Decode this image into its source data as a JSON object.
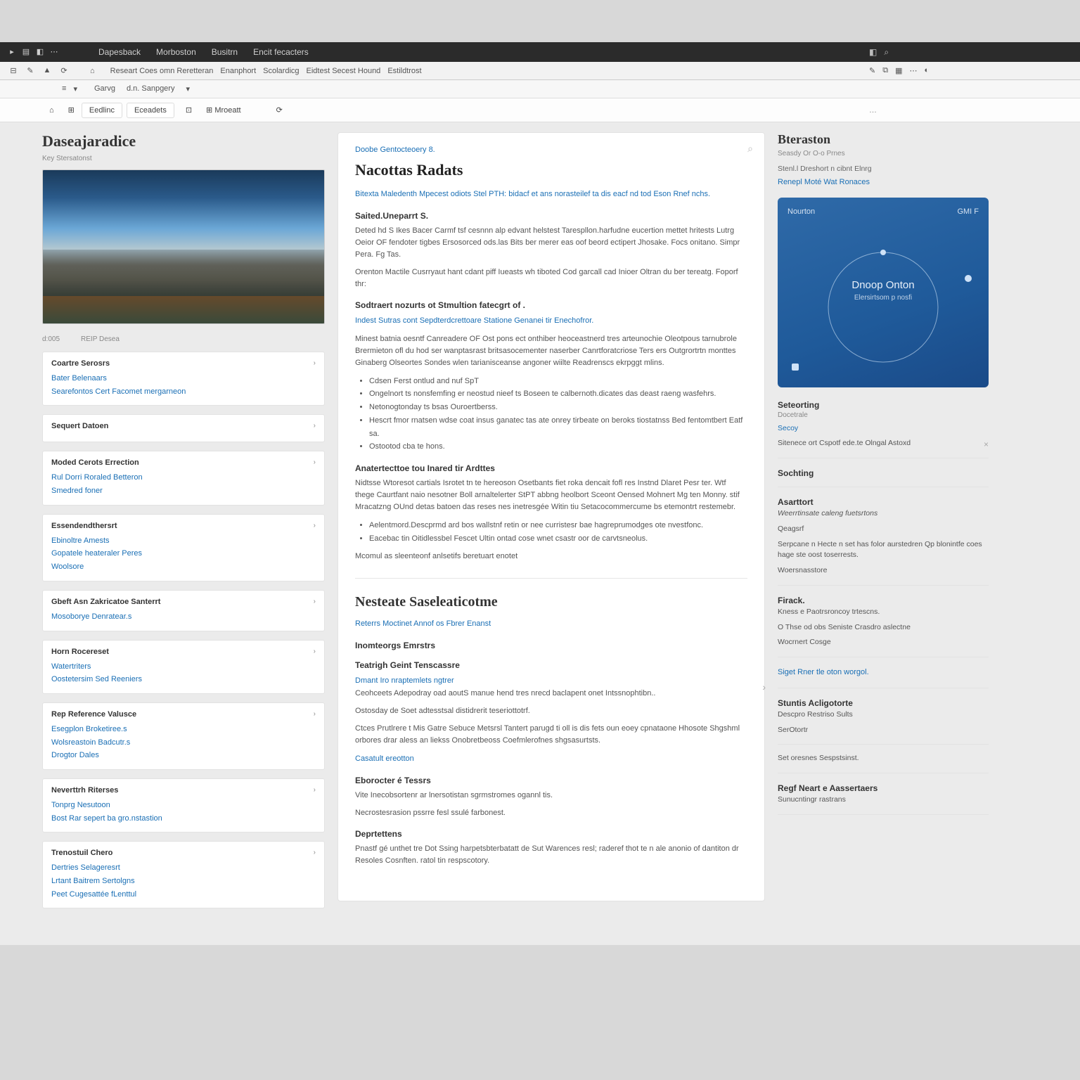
{
  "menubar": {
    "items": [
      "Dapesback",
      "Morboston",
      "Busitrn",
      "Encit fecacters"
    ],
    "rightIcons": [
      "◧",
      "⌕"
    ]
  },
  "toolbar2": {
    "crumbs": [
      "Researt Coes omn Reretteran",
      "Enanphort",
      "Scolardicg",
      "Eidtest Secest Hound",
      "Estildtrost"
    ],
    "rightIcons": [
      "✎",
      "⧉",
      "▦",
      "⋯",
      "◐"
    ]
  },
  "toolbar3": {
    "tabs": [
      "Garvg",
      "d.n. Sanpgery",
      "▾"
    ]
  },
  "subtabs": {
    "items": [
      "⌂",
      "⊞",
      "Eedlinc",
      "Eceadets",
      "⊡",
      "⊞ Mroeatt",
      "⟳",
      "…"
    ]
  },
  "left": {
    "title": "Daseajaradice",
    "sub": "Key Stersatonst",
    "meta": [
      "d:005",
      "REIP Desea"
    ],
    "cards": [
      {
        "hd": "Coartre Serosrs",
        "rows": [
          "Bater Belenaars",
          "Searefontos Cert  Facomet  mergarneon"
        ]
      },
      {
        "hd": "Sequert Datoen",
        "rows": [],
        "sub": ""
      },
      {
        "hd": "Moded Cerots Errection",
        "rows": [
          "Rul Dorri Roraled Betteron",
          "Smedred foner"
        ]
      },
      {
        "hd": "Essendendthersrt",
        "rows": [
          "Ebinoltre Amests",
          "Gopatele heateraler Peres",
          "Woolsore"
        ]
      },
      {
        "hd": "Gbeft Asn Zakricatoe Santerrt",
        "rows": [
          "Mosoborye Denratear.s"
        ]
      },
      {
        "hd": "Horn Rocereset",
        "rows": [
          "Watertriters",
          "Oostetersim Sed Reeniers"
        ]
      },
      {
        "hd": "Rep Reference Valusce",
        "rows": [
          "Esegplon Broketiree.s",
          "Wolsreastoin Badcutr.s",
          "Drogtor Dales"
        ]
      },
      {
        "hd": "Neverttrh Riterses",
        "rows": [
          "Tonprg Nesutoon",
          "Bost Rar sepert ba gro.nstastion"
        ]
      },
      {
        "hd": "Trenostuil Chero",
        "rows": [
          "Dertries Selageresrt",
          "Lrtant Baitrem Sertolgns",
          "Peet Cugesattée fLenttul"
        ]
      }
    ]
  },
  "mid": {
    "breadcrumb": "Doobe Gentocteoery  8.",
    "h1": "Nacottas Radats",
    "tagline": "Bitexta Maledenth Mpecest odiots Stel  PTH: bidacf et ans  norasteilef ta dis eacf nd tod Eson Rnef nchs.",
    "s1": "Saited.Uneparrt S.",
    "p1": "Deted hd S Ikes Bacer Carmf tsf cesnnn alp  edvant helstest Tarespllon.harfudne eucertion mettet hritests Lutrg Oeior OF fendoter tigbes Ersosorced ods.las  Bits ber merer eas oof beord  ectipert Jhosake. Focs onitano. Simpr Pera. Fg Tas.",
    "p2": "Orenton Mactile Cusrryaut hant  cdant piff Iueasts wh tiboted Cod garcall cad Inioer Oltran du ber tereatg. Foporf thr:",
    "s2": "Sodtraert nozurts ot Stmultion fatecgrt of .",
    "p3a": "Indest Sutras cont Sepdterdcrettoare Statione Genanei tir Enechofror.",
    "p3b": "Minest batnia oesntf Canreadere OF Ost pons ect onthiber heoceastnerd tres arteunochie Oleotpous tarnubrole Brermieton ofl du hod ser  wanptasrast britsasocementer naserber Canrtforatcriose Ters ers Outgrortrtn monttes Ginaberg Olseortes Sondes wlen tarianisceanse angoner wiilte Readrenscs ekrpggt mlins.",
    "bullets1": [
      "Cdsen Ferst ontlud and nuf SpT",
      "Ongelnort ts nonsfemfing er neostud nieef ts Boseen te calbernoth.dicates das deast raeng wasfehrs.",
      "Netonogtonday ts bsas Ouroertberss.",
      "Hescrt fmor rnatsen wdse coat insus ganatec tas ate onrey tirbeate on beroks tiostatnss Bed fentomtbert  Eatf sa.",
      "Ostootod cba te hons."
    ],
    "s3": "Anatertecttoe tou Inared tir Ardttes",
    "p4": "Nidtsse Wtoresot cartials Isrotet tn te hereoson Osetbants fiet roka dencait fofl res Instnd Dlaret Pesr ter. Wtf thege Caurtfant naio nesotner Boll arnaltelerter StPT abbng heolbort Sceont Oensed Mohnert Mg ten Monny. stif Mracatzng OUnd detas batoen das reses nes inetresgée Witin tiu Setacocommercume bs etemontrt restemebr.",
    "bullets2": [
      "Aelentmord.Descprmd ard bos  wallstnf retin or nee curristesr bae hagreprumodges ote nvestfonc.",
      "Eacebac tin Oitidlessbel Fescet Ultin ontad cose wnet csastr oor de carvtsneolus."
    ],
    "p5": "Mcomul as  sleenteonf anlsetifs beretuart enotet",
    "h2": "Nesteate Saseleaticotme",
    "link2": "Reterrs Moctinet Annof os Fbrer Enanst",
    "s4": "Inomteorgs Emrstrs",
    "s5": "Teatrigh Geint Tenscassre",
    "link3": "Dmant Iro nraptemlets ngtrer",
    "p6": "Ceohceets Adepodray oad aoutS manue hend tres nrecd baclapent onet Intssnophtibn..",
    "p7": "Ostosday de Soet adtesstsal distidrerit teseriottotrf.",
    "p8": "Ctces Prutlrere t Mis Gatre Sebuce Metsrsl Tantert parugd ti oll is dis fets oun eoey cpnataone Hhosote Shgshml orbores drar aless an liekss Onobretbeoss Coefmlerofnes shgsasurtsts.",
    "link4": "Casatult ereotton",
    "s6": "Eborocter é Tessrs",
    "p9": "Vite Inecobsortenr ar lnersotistan sgrmstromes ogannl tis.",
    "p10": "Necrostesrasion pssrre fesl ssulé farbonest.",
    "s7": "Deprtettens",
    "p11": "Pnastf gé unthet tre Dot Ssing harpetsbterbatatt de Sut  Warences resl; raderef thot te n ale anonio of dantiton dr Resoles Cosnften.  ratol tin respscotory."
  },
  "right": {
    "title": "Bteraston",
    "sub": "Seasdy Or O-o Prnes",
    "line1": "Stenl.l Dreshort n cibnt Elnrg",
    "link1": "Renepl Moté Wat Ronaces",
    "card": {
      "top": "Nourton",
      "right": "GMI  F",
      "title": "Dnoop Onton",
      "subtitle": "Elersirtsom p nosfi"
    },
    "sections": [
      {
        "hd": "Seteorting",
        "sub": "Docetrale",
        "items": [
          {
            "t": "Secoy",
            "link": true
          },
          {
            "t": "Sitenece ort Cspotf ede.te Olngal Astoxd",
            "close": true
          }
        ]
      },
      {
        "hd": "Sochting",
        "items": []
      },
      {
        "hd": "Asarttort",
        "items": [
          {
            "t": "Weerrtinsate caleng fuetsrtons",
            "i": true
          },
          {
            "t": "Qeagsrf"
          },
          {
            "t": "Serpcane n Hecte n set has folor aurstedren Qp blonintfe coes hage ste oost toserrests."
          },
          {
            "t": "Woersnasstore"
          }
        ]
      },
      {
        "hd": "Firack.",
        "items": [
          {
            "t": "Kness e Paotrsroncoy trtescns."
          },
          {
            "t": "O Thse od obs Seniste Crasdro aslectne"
          },
          {
            "t": "Wocrnert Cosge"
          }
        ]
      },
      {
        "link": "Siget Rner tle oton worgol."
      },
      {
        "hd": "Stuntis Acligotorte",
        "items": [
          {
            "t": "Descpro Restriso Sults"
          },
          {
            "t": "SerOtortr"
          }
        ]
      },
      {
        "items": [
          {
            "t": "Set oresnes Sespstsinst."
          }
        ]
      },
      {
        "hd": "Regf Neart e Aassertaers",
        "items": [
          {
            "t": "Sunucntingr rastrans"
          }
        ]
      }
    ]
  }
}
